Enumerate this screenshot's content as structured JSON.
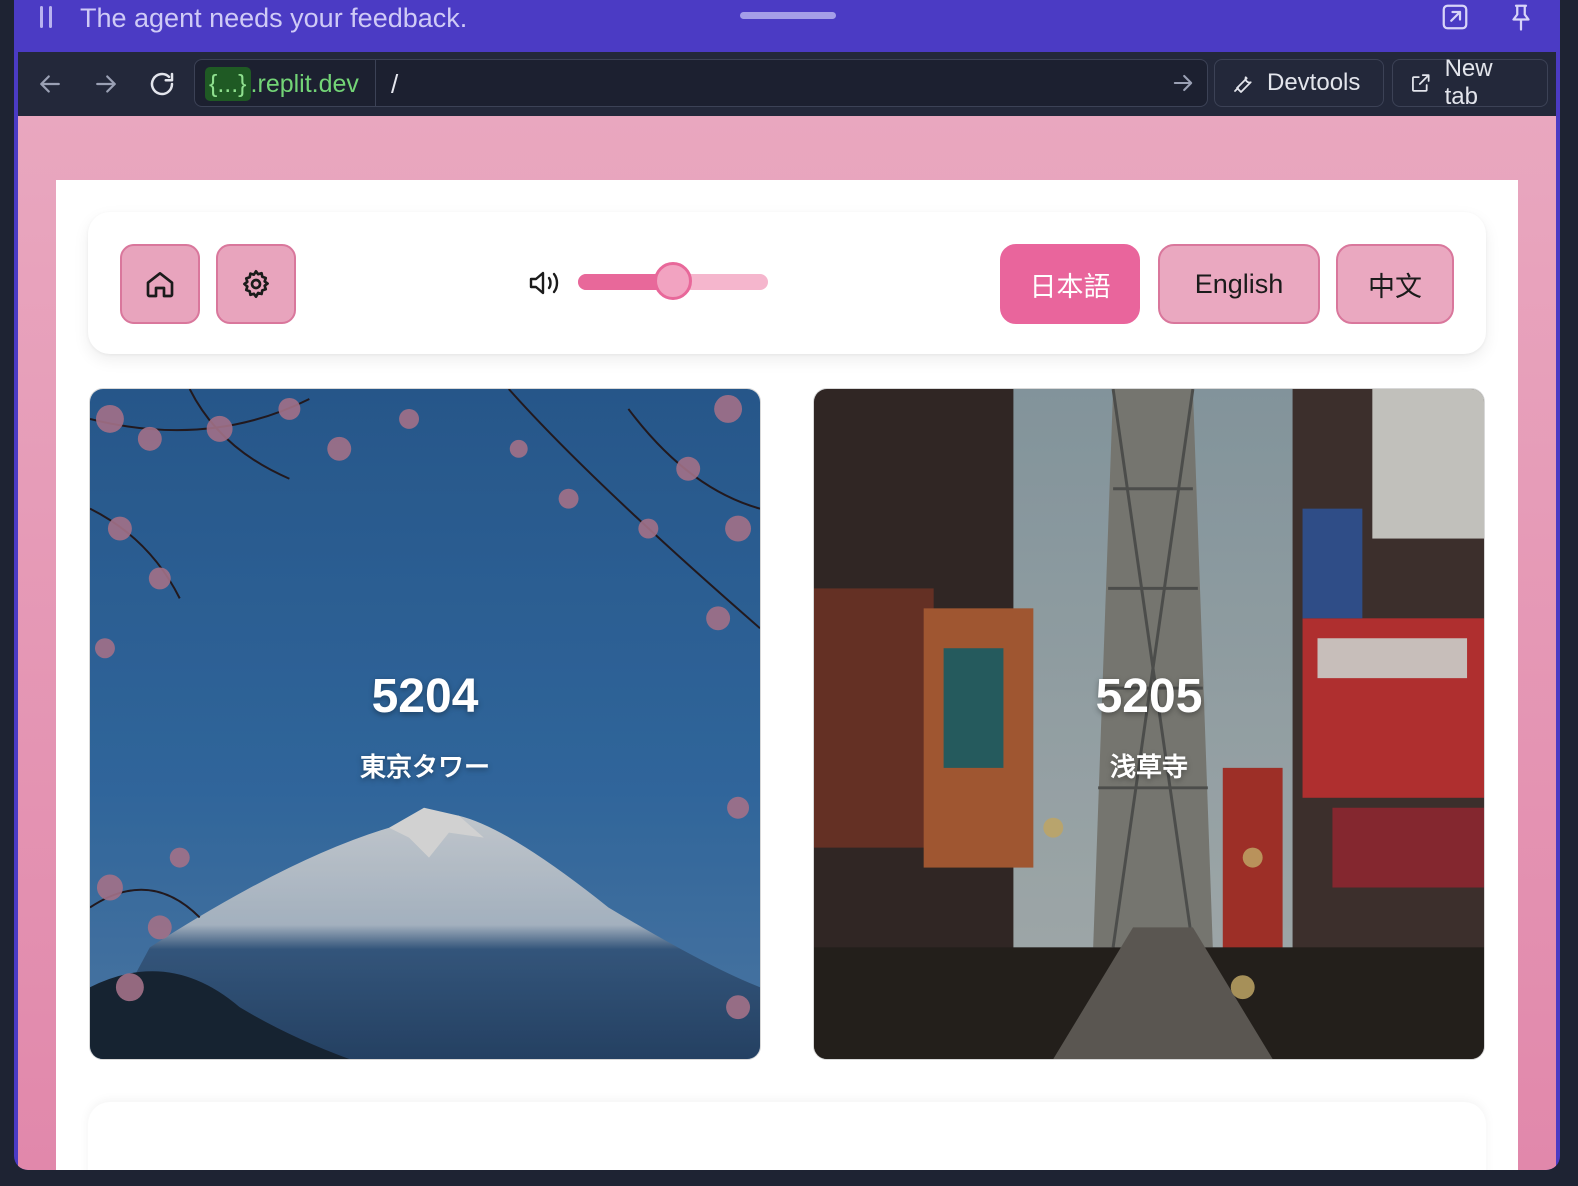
{
  "agent_bar": {
    "message": "The agent needs your feedback."
  },
  "browser": {
    "url_host_braces": "{...}",
    "url_host": ".replit.dev",
    "url_path": "/",
    "devtools_label": "Devtools",
    "new_tab_label": "New tab"
  },
  "toolbar": {
    "volume_level": 0.5,
    "languages": [
      "日本語",
      "English",
      "中文"
    ],
    "active_language": "日本語"
  },
  "cards": [
    {
      "number": "5204",
      "name": "東京タワー",
      "image": "mount-fuji-cherry-blossoms"
    },
    {
      "number": "5205",
      "name": "浅草寺",
      "image": "osaka-street-tower"
    }
  ],
  "colors": {
    "accent": "#e9659c",
    "button_bg": "#eaa8c0",
    "agent_bar": "#4b3bc4"
  }
}
